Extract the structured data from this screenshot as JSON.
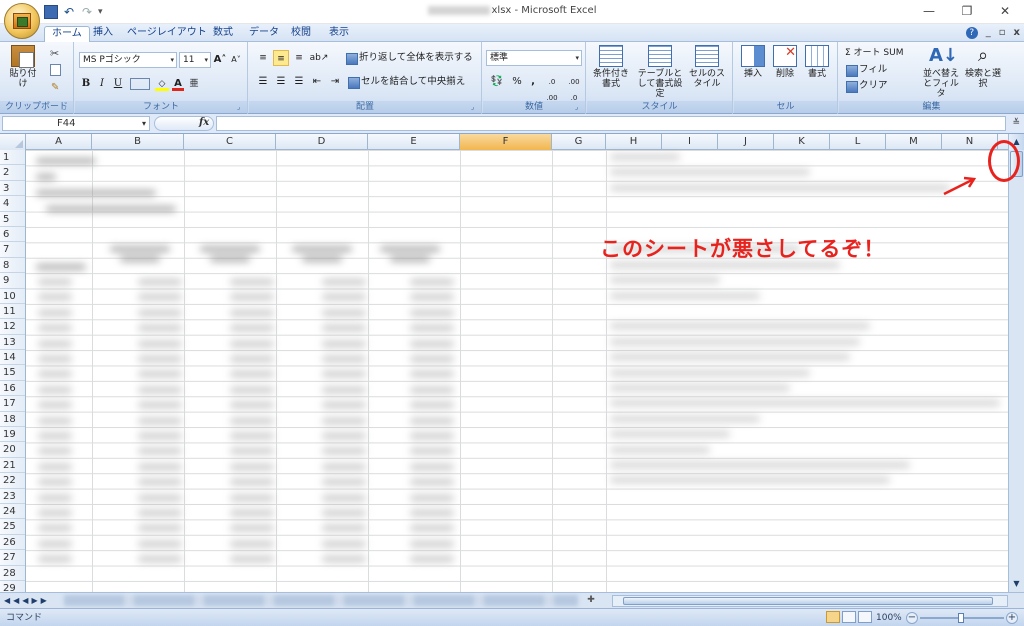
{
  "window": {
    "title_suffix": "xlsx - Microsoft Excel",
    "controls": [
      "—",
      "❐",
      "✕"
    ]
  },
  "qat": {
    "undo": "↶",
    "redo": "↷",
    "dropdown": "▾"
  },
  "tabs": [
    {
      "label": "ホーム",
      "active": true
    },
    {
      "label": "挿入"
    },
    {
      "label": "ページレイアウト"
    },
    {
      "label": "数式"
    },
    {
      "label": "データ"
    },
    {
      "label": "校閲"
    },
    {
      "label": "表示"
    }
  ],
  "ribbon_right": {
    "help": "?",
    "min": "_",
    "restore": "▫",
    "close": "x"
  },
  "ribbon": {
    "clipboard": {
      "paste": "貼り付け",
      "label": "クリップボード"
    },
    "font": {
      "name": "MS Pゴシック",
      "size": "11",
      "grow": "A˄",
      "shrink": "A˅",
      "bold": "B",
      "italic": "I",
      "underline": "U",
      "label": "フォント"
    },
    "alignment": {
      "wrap": "折り返して全体を表示する",
      "merge": "セルを結合して中央揃え",
      "label": "配置"
    },
    "number": {
      "format": "標準",
      "percent": "%",
      "comma": ",",
      "label": "数値"
    },
    "styles": {
      "conditional": "条件付き書式",
      "table": "テーブルとして書式設定",
      "cell": "セルのスタイル",
      "label": "スタイル"
    },
    "cells": {
      "insert": "挿入",
      "delete": "削除",
      "format": "書式",
      "label": "セル"
    },
    "editing": {
      "autosum": "Σ オート SUM",
      "fill": "フィル",
      "clear": "クリア",
      "sort": "並べ替えとフィルタ",
      "find": "検索と選択",
      "label": "編集"
    }
  },
  "formula_bar": {
    "name_box": "F44",
    "fx": "fx",
    "value": ""
  },
  "columns": [
    "A",
    "B",
    "C",
    "D",
    "E",
    "F",
    "G",
    "H",
    "I",
    "J",
    "K",
    "L",
    "M",
    "N"
  ],
  "selected_column": "F",
  "rows": [
    "1",
    "2",
    "3",
    "4",
    "5",
    "6",
    "7",
    "8",
    "9",
    "10",
    "11",
    "12",
    "13",
    "14",
    "15",
    "16",
    "17",
    "18",
    "19",
    "20",
    "21",
    "22",
    "23",
    "24",
    "25",
    "26",
    "27",
    "28",
    "29"
  ],
  "annotation": {
    "text": "このシートが悪さしてるぞ！",
    "color": "#e8231e"
  },
  "status": {
    "mode": "コマンド",
    "zoom": "100%"
  }
}
